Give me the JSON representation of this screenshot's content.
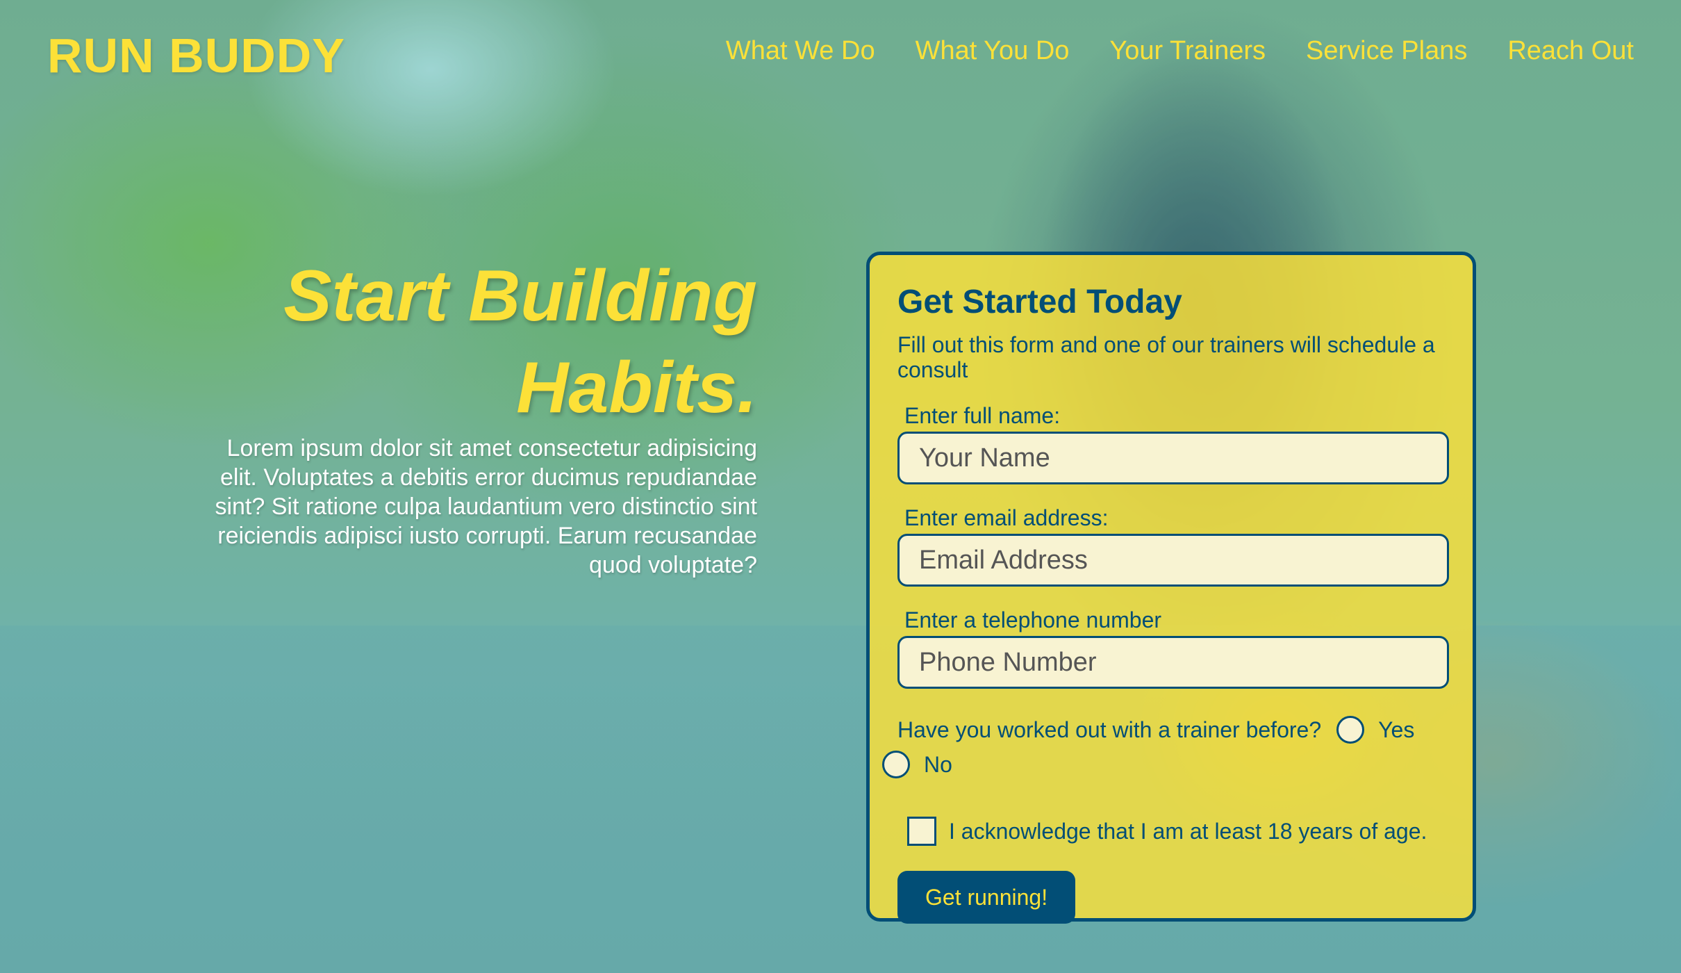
{
  "header": {
    "brand": "RUN BUDDY",
    "nav": [
      {
        "label": "What We Do"
      },
      {
        "label": "What You Do"
      },
      {
        "label": "Your Trainers"
      },
      {
        "label": "Service Plans"
      },
      {
        "label": "Reach Out"
      }
    ]
  },
  "hero": {
    "title_line1": "Start Building",
    "title_line2": "Habits.",
    "body": "Lorem ipsum dolor sit amet consectetur adipisicing elit. Voluptates a debitis error ducimus repudiandae sint? Sit ratione culpa laudantium vero distinctio sint reiciendis adipisci iusto corrupti. Earum recusandae quod voluptate?"
  },
  "form": {
    "title": "Get Started Today",
    "lead": "Fill out this form and one of our trainers will schedule a consult",
    "name_label": "Enter full name:",
    "name_placeholder": "Your Name",
    "email_label": "Enter email address:",
    "email_placeholder": "Email Address",
    "phone_label": "Enter a telephone number",
    "phone_placeholder": "Phone Number",
    "trainer_question": "Have you worked out with a trainer before?",
    "option_yes": "Yes",
    "option_no": "No",
    "age_ack": "I acknowledge that I am at least 18 years of age.",
    "submit_label": "Get running!"
  },
  "colors": {
    "accent_yellow": "#fce138",
    "dark_blue": "#024e76",
    "input_bg": "#f8f3d2"
  }
}
